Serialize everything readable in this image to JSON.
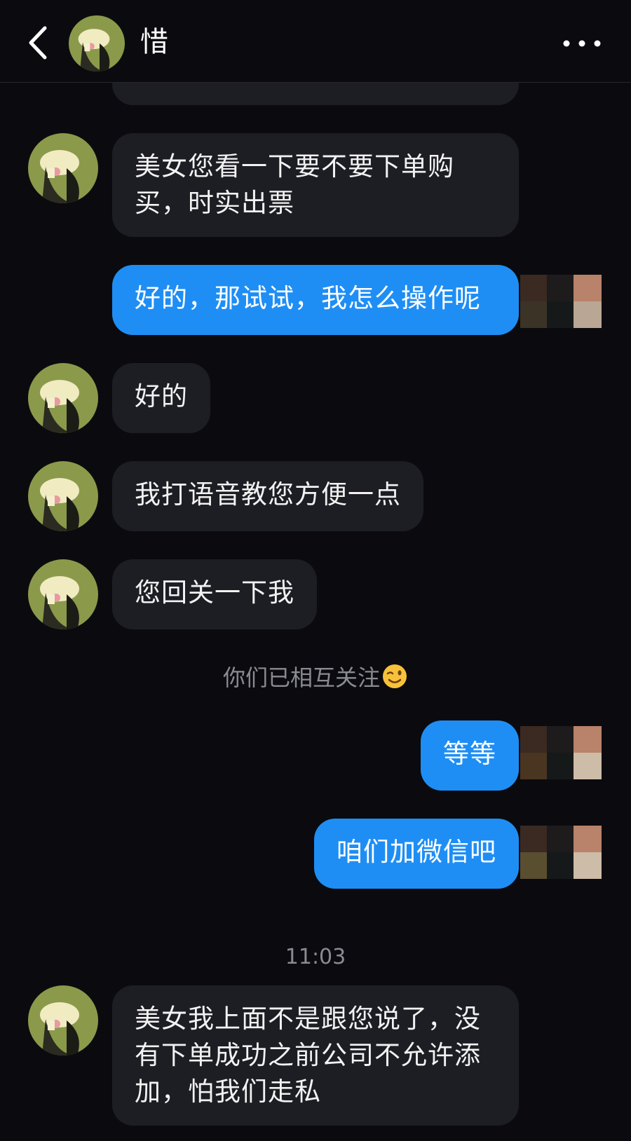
{
  "header": {
    "title": "惜",
    "back_icon": "chevron-left-icon",
    "more_icon": "more-horizontal-icon"
  },
  "messages": [
    {
      "from": "them",
      "text": "美女您看一下要不要下单购买，时实出票"
    },
    {
      "from": "me",
      "text": "好的，那试试，我怎么操作呢"
    },
    {
      "from": "them",
      "text": "好的"
    },
    {
      "from": "them",
      "text": "我打语音教您方便一点"
    },
    {
      "from": "them",
      "text": "您回关一下我"
    },
    {
      "from": "me",
      "text": "等等"
    },
    {
      "from": "me",
      "text": "咱们加微信吧"
    },
    {
      "from": "them",
      "text": "美女我上面不是跟您说了，没有下单成功之前公司不允许添加，怕我们走私"
    }
  ],
  "system": {
    "mutual_follow": "你们已相互关注",
    "mutual_follow_emoji": "wink-emoji",
    "timestamp": "11:03"
  },
  "colors": {
    "background": "#0b0b0f",
    "incoming_bubble": "#1d1d24",
    "outgoing_bubble": "#1e8ef5",
    "system_text": "#8a8a92"
  }
}
